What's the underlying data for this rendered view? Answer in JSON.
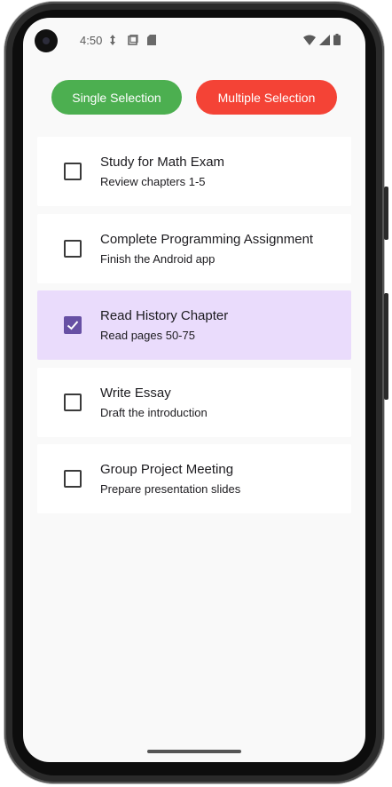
{
  "status_bar": {
    "time": "4:50",
    "icons": [
      "data-saver-icon",
      "screenshot-icon",
      "sd-card-icon",
      "wifi-icon",
      "cellular-signal-icon",
      "battery-icon"
    ]
  },
  "buttons": {
    "single_label": "Single Selection",
    "multiple_label": "Multiple Selection",
    "single_color": "#4caf50",
    "multiple_color": "#f44336"
  },
  "tasks": [
    {
      "title": "Study for Math Exam",
      "subtitle": "Review chapters 1-5",
      "checked": false
    },
    {
      "title": "Complete Programming Assignment",
      "subtitle": "Finish the Android app",
      "checked": false
    },
    {
      "title": "Read History Chapter",
      "subtitle": "Read pages 50-75",
      "checked": true
    },
    {
      "title": "Write Essay",
      "subtitle": "Draft the introduction",
      "checked": false
    },
    {
      "title": "Group Project Meeting",
      "subtitle": "Prepare presentation slides",
      "checked": false
    }
  ],
  "colors": {
    "selected_row": "#eadcfc",
    "checkbox_checked": "#6750a4"
  }
}
